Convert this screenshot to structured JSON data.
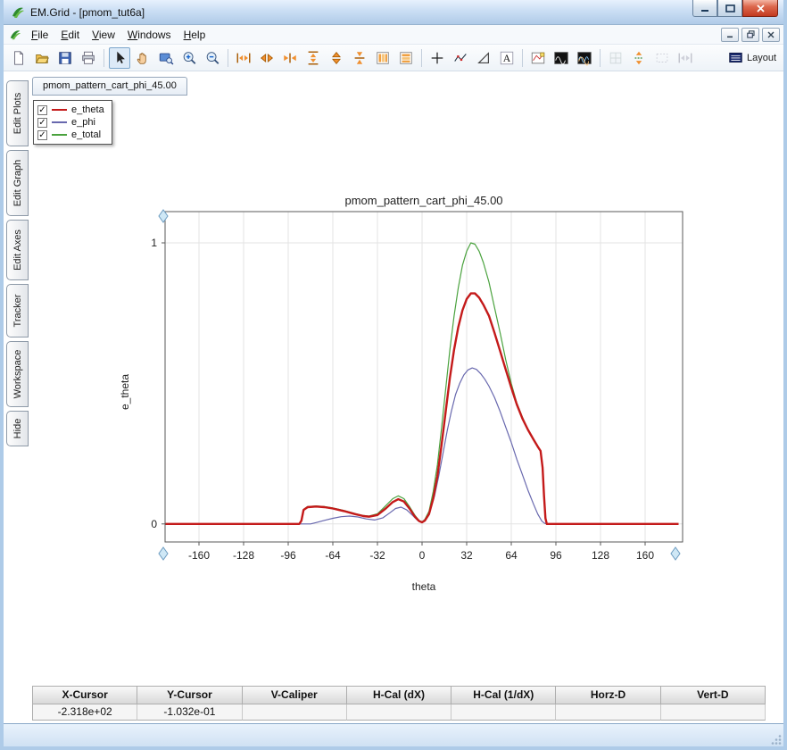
{
  "window": {
    "title": "EM.Grid - [pmom_tut6a]"
  },
  "icons": {
    "checkmark": "✓"
  },
  "menubar": {
    "items": [
      {
        "label": "File"
      },
      {
        "label": "Edit"
      },
      {
        "label": "View"
      },
      {
        "label": "Windows"
      },
      {
        "label": "Help"
      }
    ]
  },
  "toolbar": {
    "buttons": [
      "new",
      "open",
      "save",
      "print",
      "select-pointer",
      "pan-hand",
      "zoom-window",
      "zoom-in",
      "zoom-out",
      "expand-x-axis",
      "scroll-x-axis",
      "compress-x-axis",
      "expand-y-axis",
      "scroll-y-axis",
      "compress-y-axis",
      "column-layout",
      "row-layout",
      "crosshair-cursor",
      "point-tracker",
      "delta-measure",
      "add-text",
      "subplot-view",
      "waveform-view",
      "multi-waveform-view",
      "snap-grid",
      "fit-vertical",
      "select-region",
      "fit-horizontal"
    ],
    "layout_label": "Layout"
  },
  "sidebar": {
    "tabs": [
      {
        "label": "Edit Plots"
      },
      {
        "label": "Edit Graph"
      },
      {
        "label": "Edit Axes"
      },
      {
        "label": "Tracker"
      },
      {
        "label": "Workspace"
      },
      {
        "label": "Hide"
      }
    ]
  },
  "document_tab": {
    "label": "pmom_pattern_cart_phi_45.00"
  },
  "legend": {
    "items": [
      {
        "label": "e_theta",
        "color": "#c41a1a",
        "checked": true
      },
      {
        "label": "e_phi",
        "color": "#6868ae",
        "checked": true
      },
      {
        "label": "e_total",
        "color": "#4aa23e",
        "checked": true
      }
    ]
  },
  "chart_data": {
    "type": "line",
    "title": "pmom_pattern_cart_phi_45.00",
    "xlabel": "theta",
    "ylabel": "e_theta",
    "xlim": [
      -184.3,
      186.9
    ],
    "ylim": [
      -0.064,
      1.111
    ],
    "xticks": [
      -160,
      -128,
      -96,
      -64,
      -32,
      0,
      32,
      64,
      96,
      128,
      160
    ],
    "yticks": [
      0,
      1
    ],
    "grid": true,
    "legend_position": "top-left-floating",
    "series": [
      {
        "name": "e_total",
        "color": "#4aa23e",
        "width": 1.2,
        "points": [
          [
            -184,
            0
          ],
          [
            -120,
            0
          ],
          [
            -88,
            0
          ],
          [
            -86.5,
            0.014
          ],
          [
            -85,
            0.052
          ],
          [
            -82,
            0.062
          ],
          [
            -76,
            0.064
          ],
          [
            -70,
            0.062
          ],
          [
            -64,
            0.057
          ],
          [
            -56,
            0.048
          ],
          [
            -48,
            0.037
          ],
          [
            -42,
            0.03
          ],
          [
            -38,
            0.028
          ],
          [
            -32,
            0.036
          ],
          [
            -26,
            0.065
          ],
          [
            -21,
            0.09
          ],
          [
            -17,
            0.1
          ],
          [
            -13,
            0.09
          ],
          [
            -9,
            0.062
          ],
          [
            -5,
            0.03
          ],
          [
            -2,
            0.012
          ],
          [
            0,
            0.008
          ],
          [
            2,
            0.016
          ],
          [
            5,
            0.045
          ],
          [
            8,
            0.115
          ],
          [
            11,
            0.21
          ],
          [
            14,
            0.34
          ],
          [
            17,
            0.48
          ],
          [
            20,
            0.62
          ],
          [
            23,
            0.74
          ],
          [
            26,
            0.84
          ],
          [
            29,
            0.92
          ],
          [
            32,
            0.97
          ],
          [
            35,
            1.0
          ],
          [
            38,
            0.995
          ],
          [
            41,
            0.97
          ],
          [
            44,
            0.93
          ],
          [
            48,
            0.86
          ],
          [
            52,
            0.77
          ],
          [
            56,
            0.68
          ],
          [
            60,
            0.585
          ],
          [
            64,
            0.5
          ],
          [
            68,
            0.43
          ],
          [
            72,
            0.38
          ],
          [
            76,
            0.335
          ],
          [
            80,
            0.3
          ],
          [
            83,
            0.275
          ],
          [
            85,
            0.26
          ],
          [
            86.5,
            0.2
          ],
          [
            87.5,
            0.1
          ],
          [
            88.5,
            0.02
          ],
          [
            89.5,
            0
          ],
          [
            120,
            0
          ],
          [
            184,
            0
          ]
        ]
      },
      {
        "name": "e_phi",
        "color": "#6868ae",
        "width": 1.2,
        "points": [
          [
            -184,
            0
          ],
          [
            -80,
            0
          ],
          [
            -76,
            0.005
          ],
          [
            -70,
            0.013
          ],
          [
            -64,
            0.02
          ],
          [
            -58,
            0.026
          ],
          [
            -52,
            0.028
          ],
          [
            -46,
            0.025
          ],
          [
            -40,
            0.018
          ],
          [
            -34,
            0.014
          ],
          [
            -28,
            0.022
          ],
          [
            -23,
            0.04
          ],
          [
            -19,
            0.055
          ],
          [
            -15,
            0.06
          ],
          [
            -11,
            0.05
          ],
          [
            -7,
            0.032
          ],
          [
            -3,
            0.012
          ],
          [
            0,
            0.006
          ],
          [
            3,
            0.02
          ],
          [
            6,
            0.05
          ],
          [
            9,
            0.1
          ],
          [
            12,
            0.17
          ],
          [
            15,
            0.25
          ],
          [
            18,
            0.33
          ],
          [
            21,
            0.4
          ],
          [
            24,
            0.46
          ],
          [
            27,
            0.5
          ],
          [
            30,
            0.53
          ],
          [
            33,
            0.548
          ],
          [
            36,
            0.555
          ],
          [
            39,
            0.55
          ],
          [
            42,
            0.535
          ],
          [
            45,
            0.515
          ],
          [
            48,
            0.49
          ],
          [
            52,
            0.45
          ],
          [
            56,
            0.4
          ],
          [
            60,
            0.345
          ],
          [
            64,
            0.29
          ],
          [
            68,
            0.23
          ],
          [
            72,
            0.175
          ],
          [
            76,
            0.12
          ],
          [
            80,
            0.07
          ],
          [
            83,
            0.035
          ],
          [
            86,
            0.01
          ],
          [
            88,
            0.002
          ],
          [
            90,
            0
          ],
          [
            184,
            0
          ]
        ]
      },
      {
        "name": "e_theta",
        "color": "#c41a1a",
        "width": 2.4,
        "points": [
          [
            -184,
            0
          ],
          [
            -100,
            0
          ],
          [
            -88,
            0
          ],
          [
            -86.5,
            0.012
          ],
          [
            -85,
            0.05
          ],
          [
            -82,
            0.06
          ],
          [
            -76,
            0.062
          ],
          [
            -70,
            0.06
          ],
          [
            -64,
            0.055
          ],
          [
            -56,
            0.046
          ],
          [
            -48,
            0.035
          ],
          [
            -42,
            0.028
          ],
          [
            -38,
            0.026
          ],
          [
            -32,
            0.032
          ],
          [
            -26,
            0.055
          ],
          [
            -21,
            0.078
          ],
          [
            -17,
            0.088
          ],
          [
            -13,
            0.08
          ],
          [
            -9,
            0.055
          ],
          [
            -5,
            0.025
          ],
          [
            -2,
            0.01
          ],
          [
            0,
            0.006
          ],
          [
            2,
            0.012
          ],
          [
            5,
            0.035
          ],
          [
            8,
            0.09
          ],
          [
            11,
            0.17
          ],
          [
            14,
            0.28
          ],
          [
            17,
            0.4
          ],
          [
            20,
            0.52
          ],
          [
            23,
            0.62
          ],
          [
            26,
            0.7
          ],
          [
            29,
            0.76
          ],
          [
            32,
            0.8
          ],
          [
            35,
            0.82
          ],
          [
            38,
            0.82
          ],
          [
            41,
            0.805
          ],
          [
            44,
            0.78
          ],
          [
            48,
            0.74
          ],
          [
            52,
            0.68
          ],
          [
            56,
            0.615
          ],
          [
            60,
            0.55
          ],
          [
            64,
            0.485
          ],
          [
            68,
            0.425
          ],
          [
            72,
            0.375
          ],
          [
            76,
            0.335
          ],
          [
            80,
            0.3
          ],
          [
            83,
            0.275
          ],
          [
            85,
            0.26
          ],
          [
            86.5,
            0.2
          ],
          [
            87.5,
            0.1
          ],
          [
            88.5,
            0.02
          ],
          [
            89.5,
            0
          ],
          [
            100,
            0
          ],
          [
            184,
            0
          ]
        ]
      }
    ]
  },
  "cursor_table": {
    "columns": [
      {
        "header": "X-Cursor",
        "value": "-2.318e+02"
      },
      {
        "header": "Y-Cursor",
        "value": "-1.032e-01"
      },
      {
        "header": "V-Caliper",
        "value": ""
      },
      {
        "header": "H-Cal (dX)",
        "value": ""
      },
      {
        "header": "H-Cal (1/dX)",
        "value": ""
      },
      {
        "header": "Horz-D",
        "value": ""
      },
      {
        "header": "Vert-D",
        "value": ""
      }
    ]
  }
}
